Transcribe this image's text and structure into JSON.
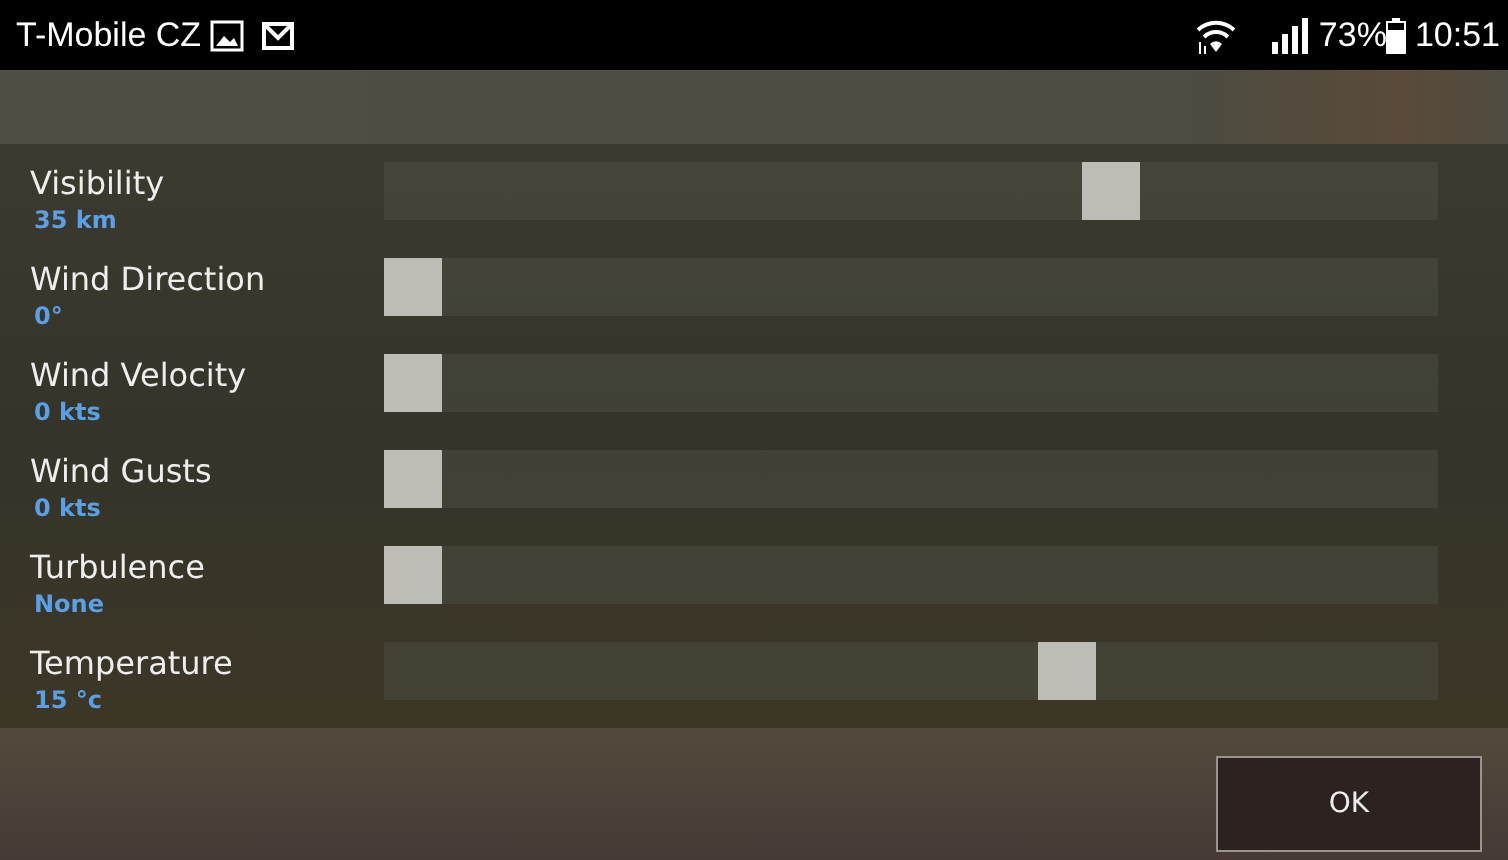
{
  "status_bar": {
    "carrier": "T-Mobile CZ",
    "battery": "73%",
    "time": "10:51"
  },
  "settings": [
    {
      "name": "Visibility",
      "value": "35 km",
      "level": 0.7
    },
    {
      "name": "Wind Direction",
      "value": "0°",
      "level": 0
    },
    {
      "name": "Wind Velocity",
      "value": "0 kts",
      "level": 0
    },
    {
      "name": "Wind Gusts",
      "value": "0 kts",
      "level": 0
    },
    {
      "name": "Turbulence",
      "value": "None",
      "level": 0
    },
    {
      "name": "Temperature",
      "value": "15 °c",
      "level": 0.657
    }
  ],
  "buttons": [
    "OK"
  ]
}
